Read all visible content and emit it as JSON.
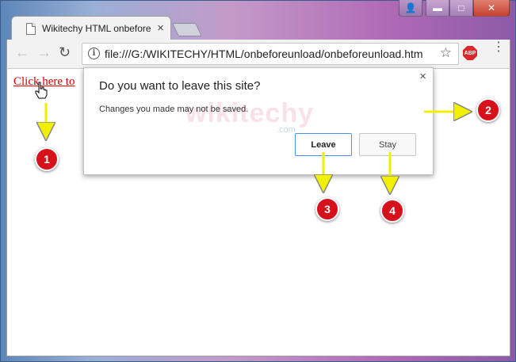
{
  "browser": {
    "tab_title": "Wikitechy HTML onbefore",
    "tab_close": "×",
    "url": "file:///G:/WIKITECHY/HTML/onbeforeunload/onbeforeunload.htm",
    "info_icon": "i",
    "star": "☆",
    "abp_label": "ABP",
    "menu": "⋮",
    "nav_back": "←",
    "nav_forward": "→",
    "reload": "↻"
  },
  "window_controls": {
    "minimize": "▬",
    "maximize": "□",
    "close": "✕",
    "user": "👤"
  },
  "page": {
    "link_text": "Click here to"
  },
  "dialog": {
    "title": "Do you want to leave this site?",
    "message": "Changes you made may not be saved.",
    "close": "×",
    "leave_label": "Leave",
    "stay_label": "Stay"
  },
  "watermark": {
    "text": "wikitechy",
    "com": ".com"
  },
  "annotations": [
    "1",
    "2",
    "3",
    "4"
  ],
  "colors": {
    "link": "#d40000",
    "annotation_badge": "#d7111b",
    "arrow": "#f0f000",
    "leave_border": "#4d90fe"
  }
}
